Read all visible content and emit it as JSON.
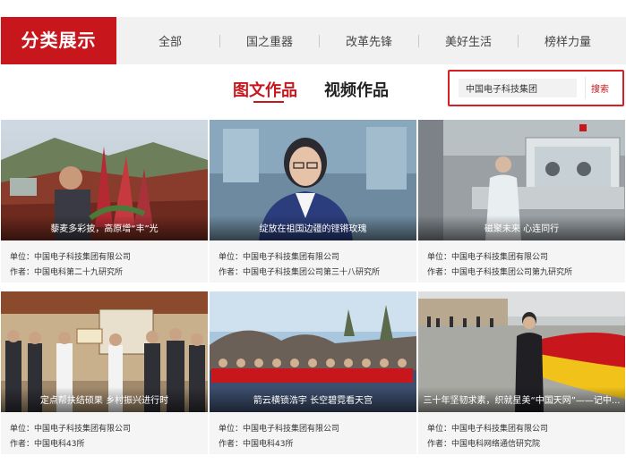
{
  "header": {
    "brand": "分类展示",
    "nav": [
      "全部",
      "国之重器",
      "改革先锋",
      "美好生活",
      "榜样力量"
    ]
  },
  "tabs": [
    "图文作品",
    "视频作品"
  ],
  "search": {
    "value": "中国电子科技集团",
    "button": "搜索"
  },
  "cards": [
    {
      "caption": "藜麦多彩披，高原增“丰”光",
      "unit": "单位：中国电子科技集团有限公司",
      "author": "作者：中国电科第二十九研究所"
    },
    {
      "caption": "绽放在祖国边疆的铿锵玫瑰",
      "unit": "单位：中国电子科技集团有限公司",
      "author": "作者：中国电子科技集团公司第三十八研究所"
    },
    {
      "caption": "磁聚未来 心连同行",
      "unit": "单位：中国电子科技集团有限公司",
      "author": "作者：中国电子科技集团公司第九研究所"
    },
    {
      "caption": "定点帮扶结硕果 乡村振兴进行时",
      "unit": "单位：中国电子科技集团有限公司",
      "author": "作者：中国电科43所"
    },
    {
      "caption": "箭云横锁浩宇 长空碧霓看天宫",
      "unit": "单位：中国电子科技集团有限公司",
      "author": "作者：中国电科43所"
    },
    {
      "caption": "三十年坚韧求素，织就星美“中国天网”——记中...",
      "unit": "单位：中国电子科技集团有限公司",
      "author": "作者：中国电科网络通信研究院"
    }
  ],
  "colors": {
    "brand": "#c8161d",
    "navbar": "#f1f1f1",
    "card": "#f5f5f5"
  }
}
